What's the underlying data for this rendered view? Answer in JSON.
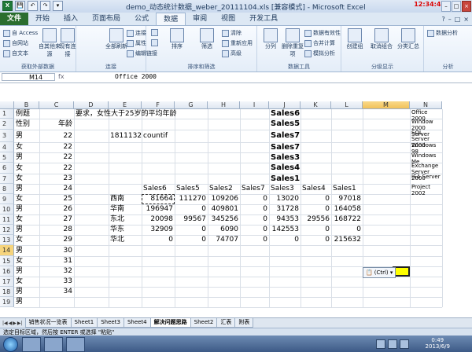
{
  "window": {
    "title": "demo_动态统计数据_weber_20111104.xls [兼容模式] - Microsoft Excel",
    "clock": "12:34:45",
    "quick_access": [
      "X",
      "💾",
      "↶",
      "↷",
      "▾"
    ]
  },
  "tabs": [
    "文件",
    "开始",
    "插入",
    "页面布局",
    "公式",
    "数据",
    "审阅",
    "视图",
    "开发工具"
  ],
  "ribbon": {
    "groups": [
      {
        "label": "获取外部数据",
        "items": [
          "自 Access",
          "自网站",
          "自文本",
          "自其他来源",
          "现有连接"
        ]
      },
      {
        "label": "连接",
        "items": [
          "全部刷新",
          "连接",
          "属性",
          "编辑链接"
        ]
      },
      {
        "label": "排序和筛选",
        "items": [
          "排序",
          "筛选",
          "清除",
          "重新应用",
          "高级"
        ]
      },
      {
        "label": "数据工具",
        "items": [
          "分列",
          "删除重复项",
          "数据有效性",
          "合并计算",
          "模拟分析"
        ]
      },
      {
        "label": "分级显示",
        "items": [
          "创建组",
          "取消组合",
          "分类汇总"
        ]
      },
      {
        "label": "分析",
        "items": [
          "数据分析"
        ]
      }
    ]
  },
  "formula_bar": {
    "name_box": "M14",
    "fx": "fx",
    "value": "Office 2000"
  },
  "columns": [
    "B",
    "C",
    "D",
    "E",
    "F",
    "G",
    "H",
    "I",
    "J",
    "K",
    "L",
    "M",
    "N"
  ],
  "selected_column": "M",
  "selected_row": "14",
  "rows": [
    "1",
    "2",
    "3",
    "4",
    "5",
    "6",
    "7",
    "8",
    "9",
    "10",
    "11",
    "12",
    "13",
    "14",
    "15",
    "16",
    "17",
    "18",
    "19"
  ],
  "sheet": {
    "b1": "例题",
    "d1": "要求，女性大于25岁的平均年龄",
    "b2": "性别",
    "c2": "年龄",
    "e3": "1811132",
    "f3": "countif",
    "gender": [
      "男",
      "女",
      "男",
      "女",
      "女",
      "男",
      "女",
      "男",
      "女",
      "男",
      "女",
      "男",
      "女",
      "男",
      "女",
      "男",
      "男",
      "男",
      "男"
    ],
    "ages": [
      "",
      "",
      "22",
      "22",
      "22",
      "22",
      "23",
      "24",
      "25",
      "26",
      "27",
      "28",
      "29",
      "30",
      "31",
      "32",
      "33",
      "34",
      ""
    ],
    "j_col": [
      "Sales6",
      "Sales5",
      "Sales7",
      "Sales7",
      "Sales3",
      "Sales4",
      "Sales1"
    ],
    "n_col": [
      "Office 2000",
      "Window 2000 Server",
      "SQL Server 2000",
      "Windows 98",
      "Windows Me",
      "Exchange Server 2000",
      "ISA Server",
      "Project 2002"
    ],
    "pivot_header": [
      "Sales6",
      "Sales5",
      "Sales2",
      "Sales7",
      "Sales3",
      "Sales4",
      "Sales1"
    ],
    "regions": [
      "西南",
      "华南",
      "东北",
      "华东",
      "华北"
    ],
    "pivot_rows": [
      [
        "81664",
        "111270",
        "109206",
        "0",
        "13020",
        "0",
        "97018"
      ],
      [
        "196947",
        "0",
        "409801",
        "0",
        "31728",
        "0",
        "164058"
      ],
      [
        "20098",
        "99567",
        "345256",
        "0",
        "94353",
        "29556",
        "168722"
      ],
      [
        "32909",
        "0",
        "6090",
        "0",
        "142553",
        "0",
        "0"
      ],
      [
        "0",
        "0",
        "74707",
        "0",
        "0",
        "0",
        "215632"
      ]
    ]
  },
  "paste_options": "(Ctrl) ▾",
  "sheet_tabs": [
    "销售状况一览表",
    "Sheet1",
    "Sheet3",
    "Sheet4",
    "解决问题思路",
    "Sheet2",
    "汇表",
    "附表"
  ],
  "status_text": "选定目标区域，然后按 ENTER 或选择 \"粘贴\"",
  "taskbar": {
    "time": "0:49",
    "date": "2013/6/9"
  }
}
